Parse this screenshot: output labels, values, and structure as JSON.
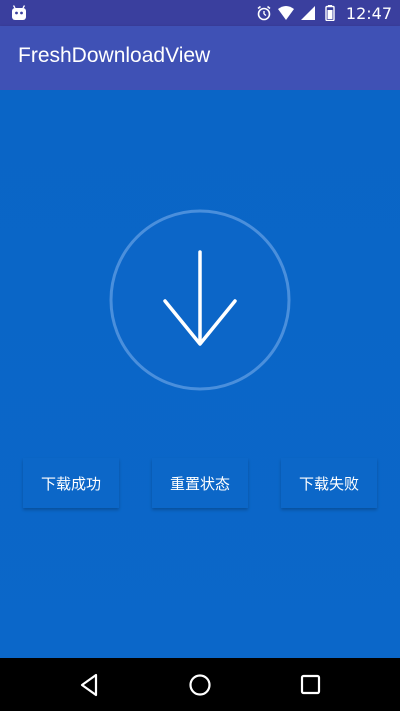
{
  "status_bar": {
    "time": "12:47",
    "icons": [
      "android-robot-icon",
      "alarm-icon",
      "wifi-icon",
      "signal-icon",
      "battery-icon"
    ]
  },
  "app_bar": {
    "title": "FreshDownloadView"
  },
  "download_view": {
    "icon": "download-arrow-icon",
    "progress": 0
  },
  "buttons": {
    "success_label": "下载成功",
    "reset_label": "重置状态",
    "fail_label": "下载失败"
  },
  "nav_bar": {
    "icons": [
      "back-icon",
      "home-icon",
      "recents-icon"
    ]
  },
  "colors": {
    "status_bar": "#3a3f9e",
    "app_bar": "#3f51b5",
    "content_background": "#0a66c8",
    "circle_stroke": "#4a8fdc",
    "arrow": "#ffffff"
  }
}
